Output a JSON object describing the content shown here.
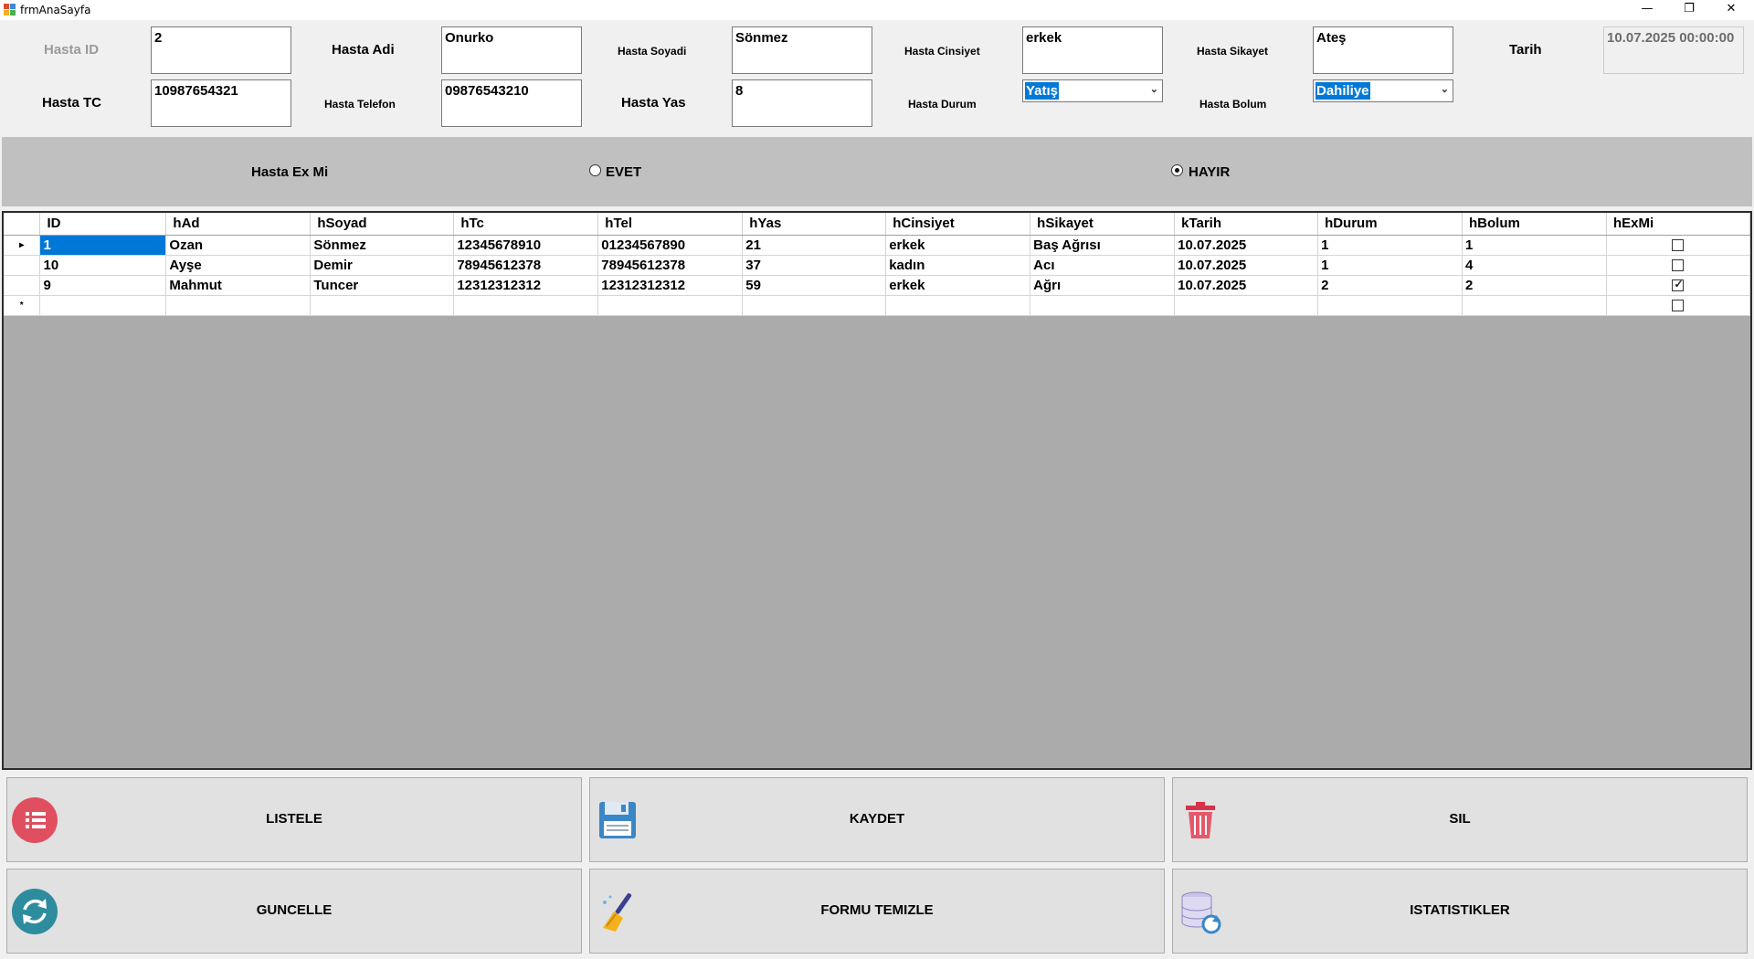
{
  "window": {
    "title": "frmAnaSayfa",
    "controls": {
      "minimize": "—",
      "restore": "❐",
      "close": "✕"
    }
  },
  "form": {
    "labels": {
      "hasta_id": "Hasta ID",
      "hasta_adi": "Hasta Adi",
      "hasta_soyadi": "Hasta Soyadi",
      "hasta_cinsiyet": "Hasta Cinsiyet",
      "hasta_sikayet": "Hasta Sikayet",
      "tarih": "Tarih",
      "hasta_tc": "Hasta TC",
      "hasta_telefon": "Hasta Telefon",
      "hasta_yas": "Hasta Yas",
      "hasta_durum": "Hasta Durum",
      "hasta_bolum": "Hasta Bolum"
    },
    "values": {
      "hasta_id": "2",
      "hasta_adi": "Onurko",
      "hasta_soyadi": "Sönmez",
      "hasta_cinsiyet": "erkek",
      "hasta_sikayet": "Ateş",
      "tarih": "10.07.2025 00:00:00",
      "hasta_tc": "10987654321",
      "hasta_telefon": "09876543210",
      "hasta_yas": "8",
      "hasta_durum": "Yatış",
      "hasta_bolum": "Dahiliye"
    }
  },
  "ex_panel": {
    "label": "Hasta Ex Mi",
    "option_yes": "EVET",
    "option_no": "HAYIR",
    "selected": "HAYIR"
  },
  "grid": {
    "columns": [
      "ID",
      "hAd",
      "hSoyad",
      "hTc",
      "hTel",
      "hYas",
      "hCinsiyet",
      "hSikayet",
      "kTarih",
      "hDurum",
      "hBolum",
      "hExMi"
    ],
    "rows": [
      {
        "ID": "1",
        "hAd": "Ozan",
        "hSoyad": "Sönmez",
        "hTc": "12345678910",
        "hTel": "01234567890",
        "hYas": "21",
        "hCinsiyet": "erkek",
        "hSikayet": "Baş Ağrısı",
        "kTarih": "10.07.2025",
        "hDurum": "1",
        "hBolum": "1",
        "hExMi": false
      },
      {
        "ID": "10",
        "hAd": "Ayşe",
        "hSoyad": "Demir",
        "hTc": "78945612378",
        "hTel": "78945612378",
        "hYas": "37",
        "hCinsiyet": "kadın",
        "hSikayet": "Acı",
        "kTarih": "10.07.2025",
        "hDurum": "1",
        "hBolum": "4",
        "hExMi": false
      },
      {
        "ID": "9",
        "hAd": "Mahmut",
        "hSoyad": "Tuncer",
        "hTc": "12312312312",
        "hTel": "12312312312",
        "hYas": "59",
        "hCinsiyet": "erkek",
        "hSikayet": "Ağrı",
        "kTarih": "10.07.2025",
        "hDurum": "2",
        "hBolum": "2",
        "hExMi": true
      }
    ],
    "current_row_marker": "▸",
    "new_row_marker": "*"
  },
  "buttons": {
    "listele": "LISTELE",
    "kaydet": "KAYDET",
    "sil": "SIL",
    "guncelle": "GUNCELLE",
    "formu_temizle": "FORMU TEMIZLE",
    "istatistikler": "ISTATISTIKLER"
  },
  "colors": {
    "selection": "#0078d7",
    "panel": "#c0c0c0",
    "grid_background": "#ababab",
    "button_face": "#e1e1e1",
    "list_icon": "#e04f5f",
    "refresh_icon": "#2d8c9e",
    "save_icon": "#3a87c8",
    "trash_icon": "#d6334a"
  }
}
